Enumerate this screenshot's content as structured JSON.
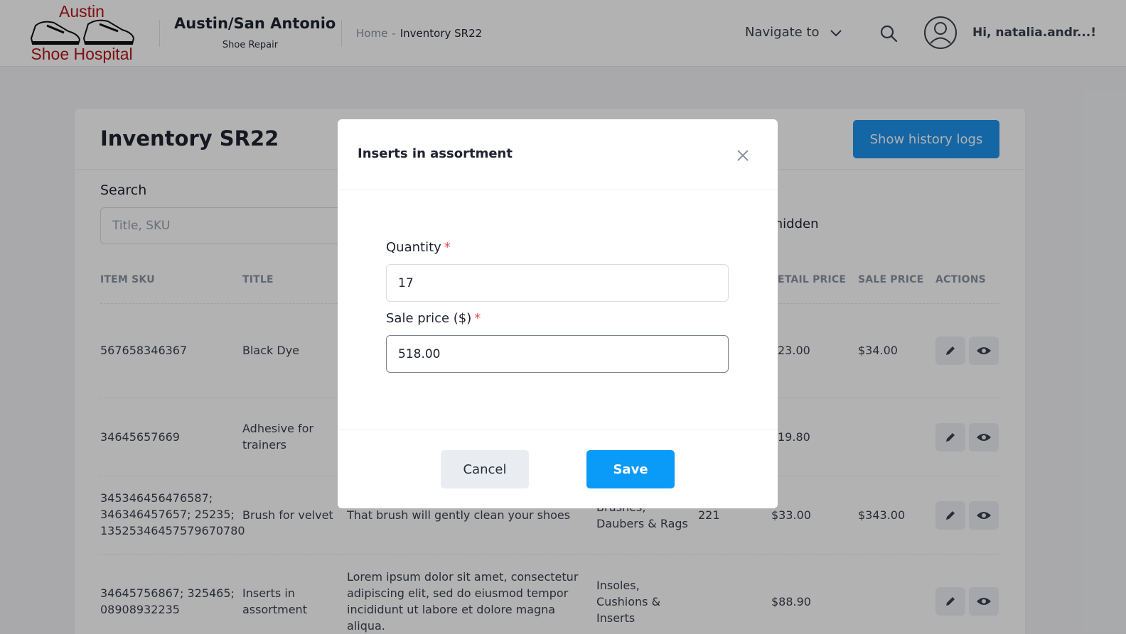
{
  "header": {
    "logo_line1": "Austin",
    "logo_line2": "Shoe Hospital",
    "brand_title": "Austin/San Antonio",
    "brand_subtitle": "Shoe Repair",
    "breadcrumb": {
      "home": "Home",
      "separator": "-",
      "current": "Inventory SR22"
    },
    "navigate_label": "Navigate to",
    "greeting": "Hi, natalia.andr...!"
  },
  "page": {
    "title": "Inventory SR22",
    "history_button": "Show history logs",
    "search_label": "Search",
    "search_placeholder": "Title, SKU",
    "hidden_label": "hidden"
  },
  "table": {
    "columns": {
      "sku": "ITEM SKU",
      "title": "TITLE",
      "retail": "ETAIL PRICE",
      "sale": "SALE PRICE",
      "actions": "ACTIONS"
    },
    "rows": [
      {
        "sku": [
          "567658346367"
        ],
        "title": [
          "Black Dye"
        ],
        "description": [],
        "category": [],
        "qty": "",
        "retail": "23.00",
        "sale": "$34.00"
      },
      {
        "sku": [
          "34645657669"
        ],
        "title": [
          "Adhesive for",
          "trainers"
        ],
        "description": [],
        "category": [],
        "qty": "",
        "retail": "19.80",
        "sale": ""
      },
      {
        "sku": [
          "345346456476587;",
          "346346457657; 25235;",
          "13525346457579670780"
        ],
        "title": [
          "Brush for velvet"
        ],
        "description": [
          "That brush will gently clean your shoes"
        ],
        "category": [
          "Brushes,",
          "Daubers & Rags"
        ],
        "qty": "221",
        "retail": "$33.00",
        "sale": "$343.00"
      },
      {
        "sku": [
          "34645756867; 325465;",
          "08908932235"
        ],
        "title": [
          "Inserts in",
          "assortment"
        ],
        "description": [
          "Lorem ipsum dolor sit amet, consectetur",
          "adipiscing elit, sed do eiusmod tempor",
          "incididunt ut labore et dolore magna",
          "aliqua."
        ],
        "category": [
          "Insoles,",
          "Cushions &",
          "Inserts"
        ],
        "qty": "",
        "retail": "$88.90",
        "sale": ""
      }
    ]
  },
  "modal": {
    "title": "Inserts in assortment",
    "quantity_label": "Quantity",
    "quantity_value": "17",
    "sale_price_label": "Sale price ($)",
    "sale_price_value": "518.00",
    "required_mark": "*",
    "cancel_label": "Cancel",
    "save_label": "Save"
  },
  "colors": {
    "primary": "#1f93ec",
    "save": "#0a9af7",
    "logo_red": "#b3161b",
    "required": "#e5484d"
  },
  "icons": [
    "chevron-down-icon",
    "search-icon",
    "user-avatar-icon",
    "close-icon",
    "pencil-icon",
    "eye-icon"
  ]
}
